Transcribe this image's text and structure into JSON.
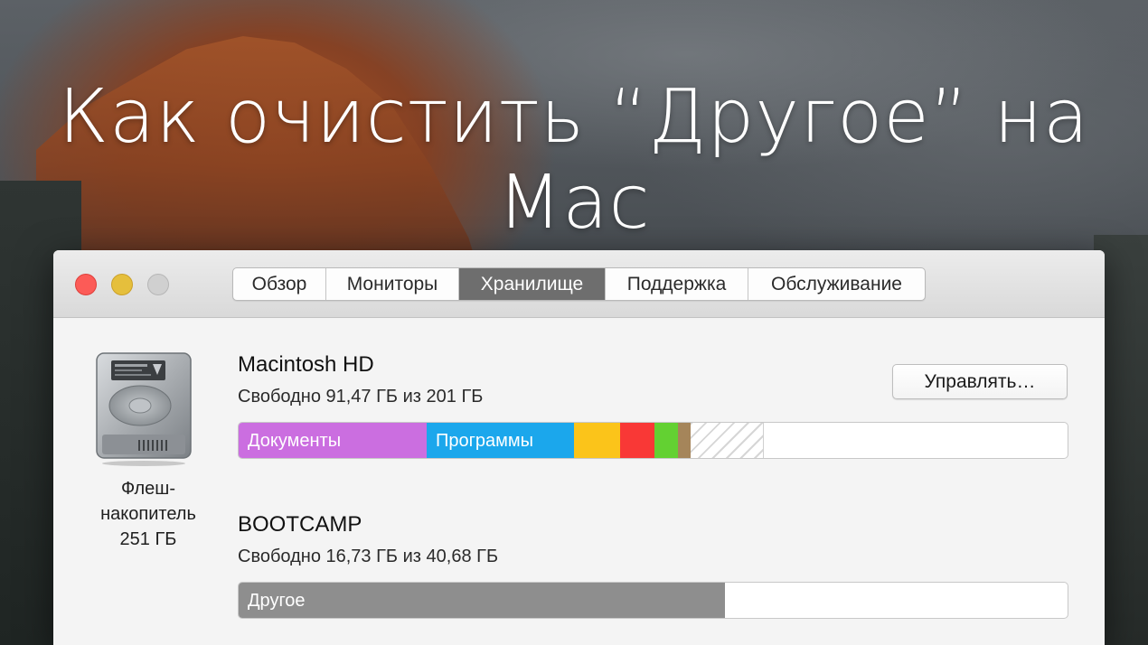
{
  "headline": "Как очистить “Другое” на Mac",
  "tabs": [
    {
      "label": "Обзор",
      "active": false
    },
    {
      "label": "Мониторы",
      "active": false
    },
    {
      "label": "Хранилище",
      "active": true
    },
    {
      "label": "Поддержка",
      "active": false
    },
    {
      "label": "Обслуживание",
      "active": false
    }
  ],
  "drive": {
    "icon": "hard-drive-icon",
    "caption_line1": "Флеш-",
    "caption_line2": "накопитель",
    "caption_line3": "251 ГБ"
  },
  "volumes": [
    {
      "name": "Macintosh HD",
      "free": "Свободно 91,47 ГБ из 201 ГБ",
      "manage_label": "Управлять…",
      "segments": [
        {
          "label": "Документы",
          "color": "#cb6ee0",
          "fraction": 0.227
        },
        {
          "label": "Программы",
          "color": "#1ba7ec",
          "fraction": 0.178
        },
        {
          "label": "",
          "color": "#fbc41a",
          "fraction": 0.056
        },
        {
          "label": "",
          "color": "#f93836",
          "fraction": 0.041
        },
        {
          "label": "",
          "color": "#63d132",
          "fraction": 0.028
        },
        {
          "label": "",
          "color": "#a5855a",
          "fraction": 0.015
        },
        {
          "label": "",
          "color": "striped",
          "fraction": 0.088
        }
      ]
    },
    {
      "name": "BOOTCAMP",
      "free": "Свободно 16,73 ГБ из 40,68 ГБ",
      "segments": [
        {
          "label": "Другое",
          "color": "#8e8e8e",
          "fraction": 0.587
        }
      ]
    }
  ],
  "colors": {
    "close": "#fc5b57",
    "minimize": "#e5bf3c",
    "zoom": "#d0d0d0",
    "active_tab": "#6e6e6e"
  }
}
